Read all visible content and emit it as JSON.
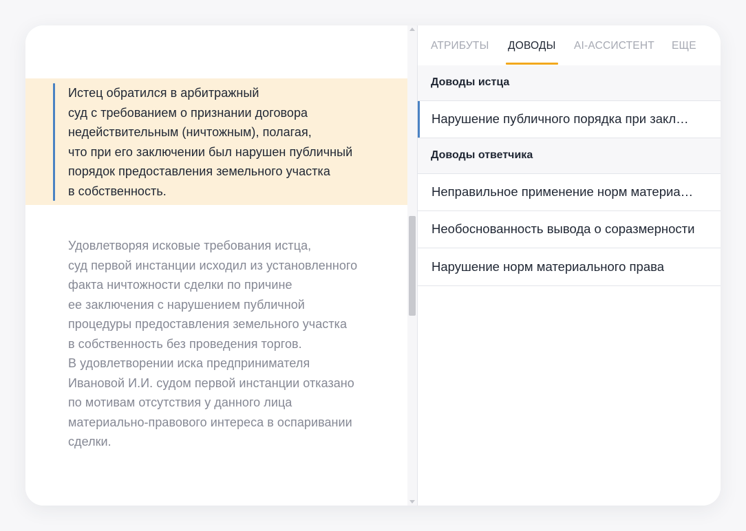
{
  "document": {
    "highlighted_paragraph": [
      "Истец обратился в арбитражный",
      "суд с требованием о признании договора",
      "недействительным (ничтожным), полагая,",
      "что при его заключении был нарушен публичный",
      "порядок предоставления земельного участка",
      "в собственность."
    ],
    "paragraph": [
      "Удовлетворяя исковые требования истца,",
      "суд первой инстанции исходил из установленного",
      "факта ничтожности сделки по причине",
      "ее заключения с нарушением публичной",
      "процедуры предоставления земельного участка",
      "в собственность без проведения торгов.",
      "В удовлетворении иска предпринимателя",
      "Ивановой И.И. судом первой инстанции отказано",
      "по мотивам отсутствия у данного лица",
      "материально-правового интереса в оспаривании",
      "сделки."
    ]
  },
  "tabs": [
    {
      "label": "АТРИБУТЫ"
    },
    {
      "label": "ДОВОДЫ",
      "active": true
    },
    {
      "label": "AI-АССИСТЕНТ"
    },
    {
      "label": "ЕЩЕ"
    }
  ],
  "arguments": {
    "plaintiff": {
      "title": "Доводы истца",
      "items": [
        "Нарушение публичного порядка при заключении договора"
      ]
    },
    "defendant": {
      "title": "Доводы ответчика",
      "items": [
        "Неправильное применение норм материального права",
        "Необоснованность вывода о соразмерности",
        "Нарушение норм материального права"
      ]
    }
  },
  "colors": {
    "highlight": "#fdf0d9",
    "accent_blue": "#4a82c3",
    "tab_underline": "#f2a81d"
  }
}
